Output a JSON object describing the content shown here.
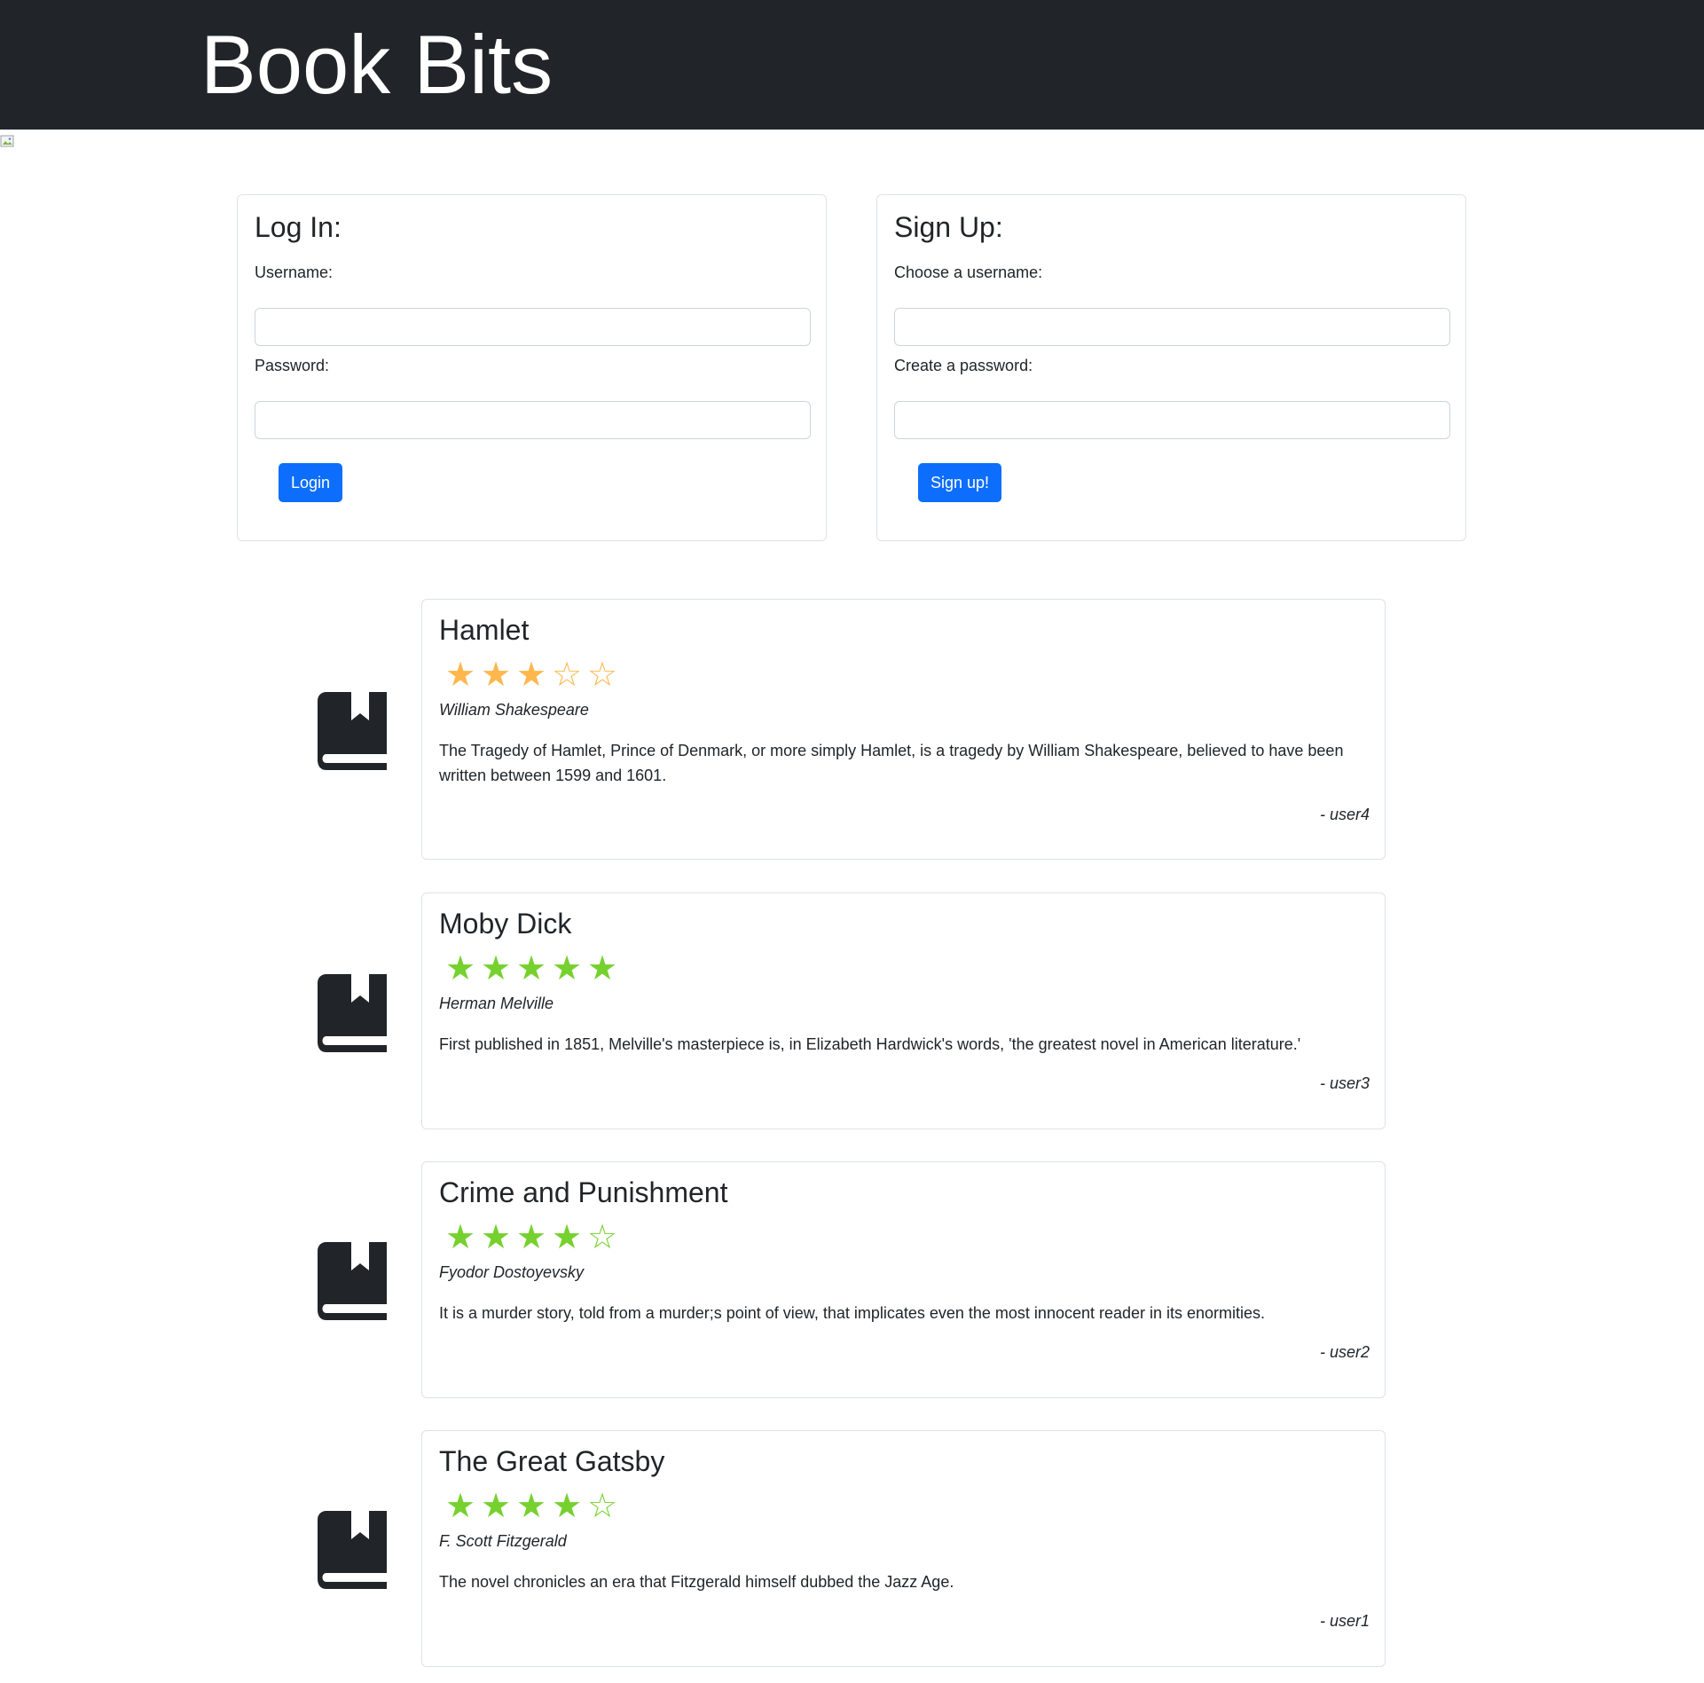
{
  "header": {
    "title": "Book Bits"
  },
  "login": {
    "heading": "Log In:",
    "username_label": "Username:",
    "password_label": "Password:",
    "button_label": "Login"
  },
  "signup": {
    "heading": "Sign Up:",
    "username_label": "Choose a username:",
    "password_label": "Create a password:",
    "button_label": "Sign up!"
  },
  "reviews": [
    {
      "title": "Hamlet",
      "rating": 3,
      "star_color": "#ffb74d",
      "author": "William Shakespeare",
      "text": "The Tragedy of Hamlet, Prince of Denmark, or more simply Hamlet, is a tragedy by William Shakespeare, believed to have been written between 1599 and 1601.",
      "user": "- user4"
    },
    {
      "title": "Moby Dick",
      "rating": 5,
      "star_color": "#76d12f",
      "author": "Herman Melville",
      "text": "First published in 1851, Melville's masterpiece is, in Elizabeth Hardwick's words, 'the greatest novel in American literature.'",
      "user": "- user3"
    },
    {
      "title": "Crime and Punishment",
      "rating": 4,
      "star_color": "#76d12f",
      "author": "Fyodor Dostoyevsky",
      "text": "It is a murder story, told from a murder;s point of view, that implicates even the most innocent reader in its enormities.",
      "user": "- user2"
    },
    {
      "title": "The Great Gatsby",
      "rating": 4,
      "star_color": "#76d12f",
      "author": "F. Scott Fitzgerald",
      "text": "The novel chronicles an era that Fitzgerald himself dubbed the Jazz Age.",
      "user": "- user1"
    }
  ],
  "icons": {
    "book": "book-bookmark-icon",
    "broken_image": "broken-image-icon"
  },
  "colors": {
    "header_bg": "#212529",
    "primary": "#0d6efd"
  }
}
